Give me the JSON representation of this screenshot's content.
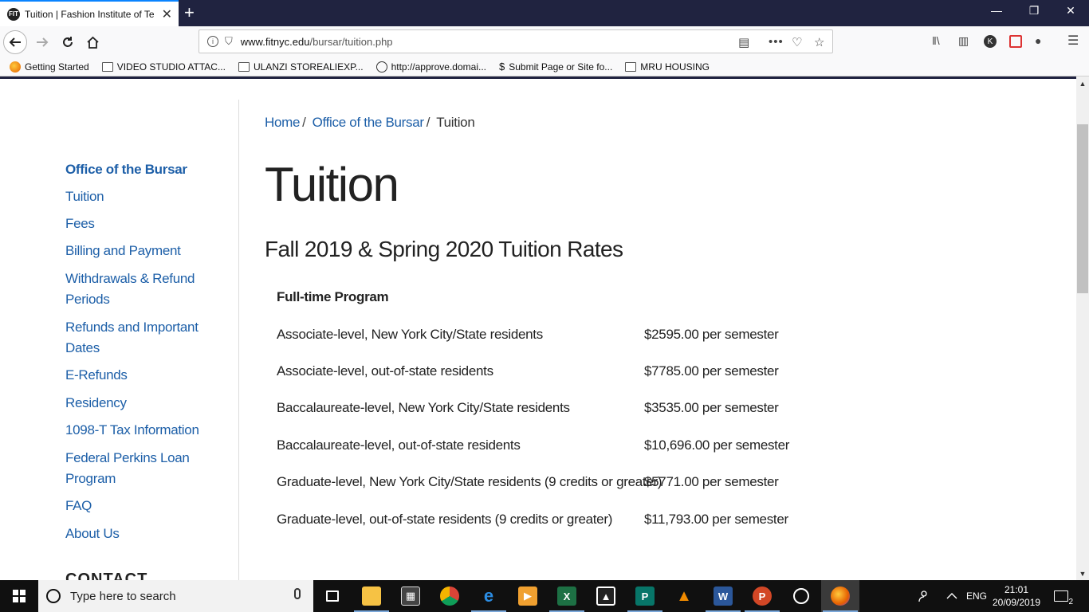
{
  "browser": {
    "tab_title": "Tuition | Fashion Institute of Te",
    "tab_favicon": "FIT",
    "url_domain": "www.fitnyc.edu",
    "url_path": "/bursar/tuition.php",
    "bookmarks": [
      {
        "label": "Getting Started",
        "icon": "firefox-icon"
      },
      {
        "label": "VIDEO STUDIO ATTAC...",
        "icon": "folder-icon"
      },
      {
        "label": "ULANZI STOREALIEXP...",
        "icon": "folder-icon"
      },
      {
        "label": "http://approve.domai...",
        "icon": "globe-icon"
      },
      {
        "label": "Submit Page or Site fo...",
        "icon": "s-icon"
      },
      {
        "label": "MRU HOUSING",
        "icon": "folder-icon"
      }
    ]
  },
  "sidebar": {
    "items": [
      {
        "label": "Office of the Bursar",
        "active": true
      },
      {
        "label": "Tuition"
      },
      {
        "label": "Fees"
      },
      {
        "label": "Billing and Payment"
      },
      {
        "label": "Withdrawals & Refund"
      },
      {
        "label": "Periods"
      },
      {
        "label": "Refunds and Important"
      },
      {
        "label": "Dates"
      },
      {
        "label": "E-Refunds"
      },
      {
        "label": "Residency"
      },
      {
        "label": "1098-T Tax Information"
      },
      {
        "label": "Federal Perkins Loan"
      },
      {
        "label": "Program"
      },
      {
        "label": "FAQ"
      },
      {
        "label": "About Us"
      }
    ],
    "contact_heading": "CONTACT"
  },
  "breadcrumb": {
    "home": "Home",
    "bursar": "Office of the Bursar",
    "current": "Tuition",
    "separator": "/"
  },
  "page": {
    "title": "Tuition",
    "subtitle": "Fall 2019 & Spring 2020 Tuition Rates",
    "table_header": "Full-time Program",
    "rows": [
      {
        "label": "Associate-level, New York City/State residents",
        "value": "$2595.00 per semester"
      },
      {
        "label": "Associate-level, out-of-state residents",
        "value": "$7785.00 per semester"
      },
      {
        "label": "Baccalaureate-level, New York City/State residents",
        "value": "$3535.00 per semester"
      },
      {
        "label": "Baccalaureate-level, out-of-state residents",
        "value": "$10,696.00 per semester"
      },
      {
        "label": "Graduate-level, New York City/State residents (9 credits or greater)",
        "value": "$5771.00 per semester"
      },
      {
        "label": "Graduate-level, out-of-state residents (9 credits or greater)",
        "value": "$11,793.00 per semester"
      }
    ]
  },
  "taskbar": {
    "search_placeholder": "Type here to search",
    "language": "ENG",
    "time": "21:01",
    "date": "20/09/2019",
    "notifications": "2"
  },
  "colors": {
    "link": "#1d5fa8",
    "tabbar": "#202340",
    "taskbar": "#101010"
  }
}
